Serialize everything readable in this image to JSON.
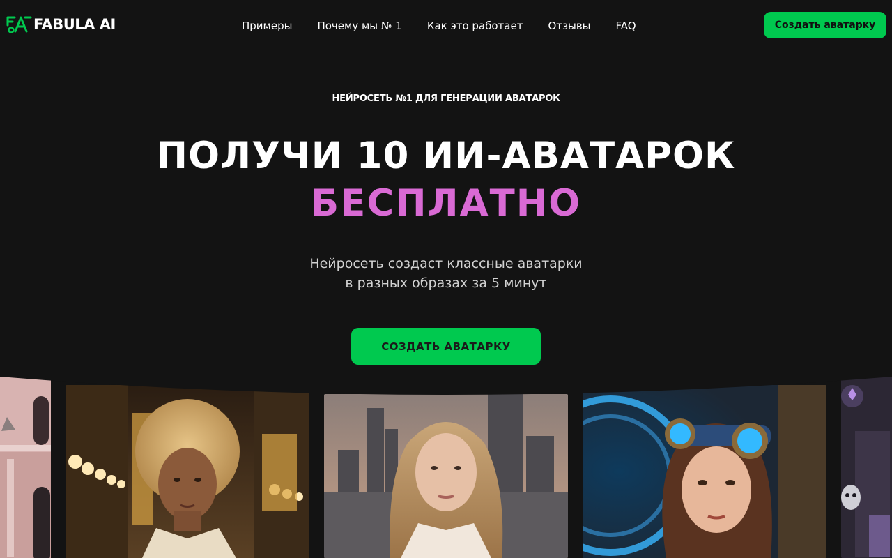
{
  "header": {
    "logo_text": "FABULA AI",
    "nav": [
      "Примеры",
      "Почему мы № 1",
      "Как это работает",
      "Отзывы",
      "FAQ"
    ],
    "cta_label": "Создать аватарку"
  },
  "hero": {
    "eyebrow": "НЕЙРОСЕТЬ №1 ДЛЯ ГЕНЕРАЦИИ АВАТАРОК",
    "headline": "ПОЛУЧИ 10 ИИ-АВАТАРОК",
    "headline_accent": "БЕСПЛАТНО",
    "subtitle_line1": "Нейросеть создаст классные аватарки",
    "subtitle_line2": "в разных образах за 5 минут",
    "cta_label": "СОЗДАТЬ АВАТАРКУ"
  },
  "gallery": {
    "cards": [
      {
        "subject": "pink-building-photo"
      },
      {
        "subject": "curly-haired-woman-in-cafe"
      },
      {
        "subject": "blonde-woman-city-skyline"
      },
      {
        "subject": "steampunk-girl-with-goggles"
      },
      {
        "subject": "dark-fantasy-skull"
      }
    ]
  },
  "colors": {
    "background": "#131313",
    "accent_green": "#00c94f",
    "accent_pink": "#d96ad4",
    "text": "#ffffff",
    "muted_text": "#d2d2d2"
  }
}
